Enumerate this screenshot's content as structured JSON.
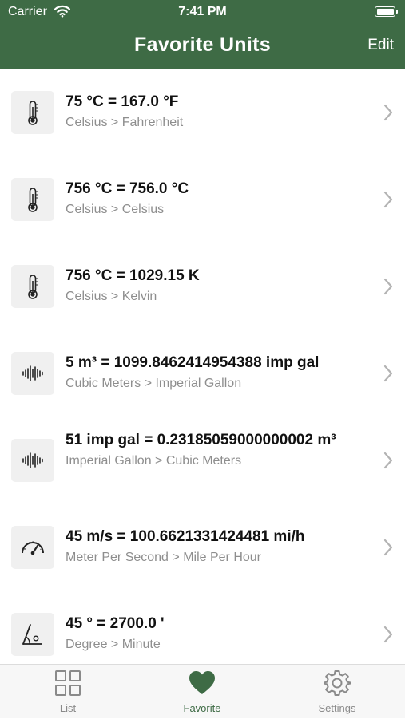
{
  "status_bar": {
    "carrier": "Carrier",
    "time": "7:41 PM"
  },
  "header": {
    "title": "Favorite Units",
    "edit_label": "Edit"
  },
  "favorites": [
    {
      "icon": "thermometer-icon",
      "title": "75 °C = 167.0 °F",
      "subtitle": "Celsius > Fahrenheit"
    },
    {
      "icon": "thermometer-icon",
      "title": "756 °C = 756.0 °C",
      "subtitle": "Celsius > Celsius"
    },
    {
      "icon": "thermometer-icon",
      "title": "756 °C = 1029.15 K",
      "subtitle": "Celsius > Kelvin"
    },
    {
      "icon": "waveform-icon",
      "title": "5 m³ = 1099.8462414954388 imp gal",
      "subtitle": "Cubic Meters > Imperial Gallon"
    },
    {
      "icon": "waveform-icon",
      "title": "51 imp gal = 0.23185059000000002 m³",
      "subtitle": "Imperial Gallon > Cubic Meters"
    },
    {
      "icon": "speedometer-icon",
      "title": "45 m/s = 100.6621331424481 mi/h",
      "subtitle": "Meter Per Second > Mile Per Hour"
    },
    {
      "icon": "angle-icon",
      "title": "45 ° = 2700.0 '",
      "subtitle": "Degree > Minute"
    }
  ],
  "tabbar": {
    "tabs": [
      {
        "label": "List",
        "icon": "grid-icon",
        "active": false
      },
      {
        "label": "Favorite",
        "icon": "heart-icon",
        "active": true
      },
      {
        "label": "Settings",
        "icon": "gear-icon",
        "active": false
      }
    ]
  },
  "colors": {
    "accent": "#3e6b45",
    "subtitle": "#8e8e8e",
    "icon_bg": "#f0f0f0"
  }
}
